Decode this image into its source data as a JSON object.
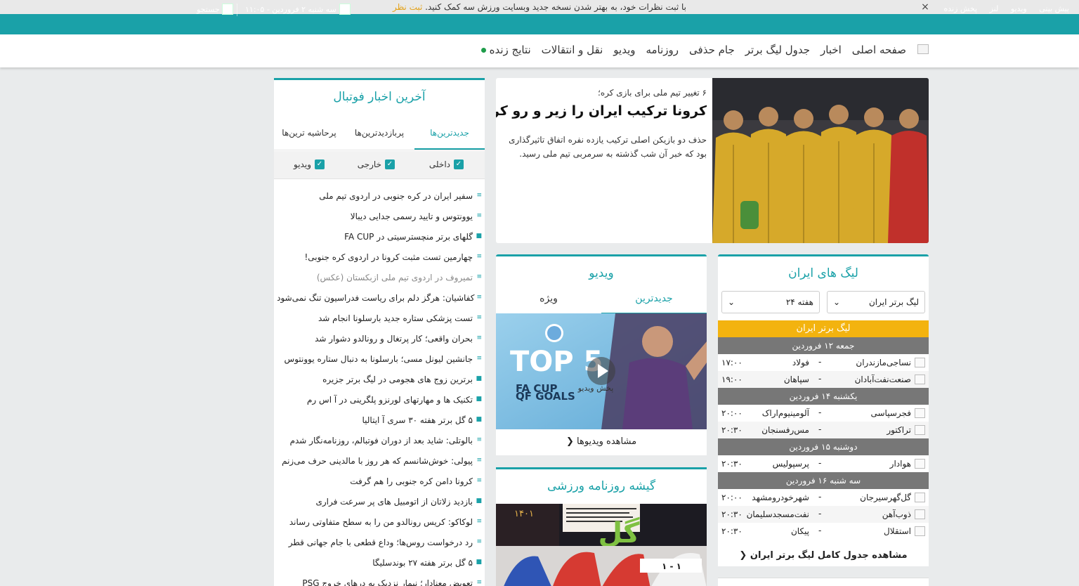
{
  "notice": {
    "text": "با ثبت نظرات خود، به بهتر شدن نسخه جدید وبسایت ورزش سه کمک کنید.",
    "cta": "ثبت نظر",
    "close": "×"
  },
  "topbar": {
    "links": [
      "پیش بینی",
      "ویدیو",
      "لنز",
      "پخش زنده"
    ],
    "date": "سه شنبه ۲ فروردین - ۱۱:۰۵",
    "search": "جستجو"
  },
  "nav": {
    "items": [
      "صفحه اصلی",
      "اخبار",
      "جدول لیگ برتر",
      "جام حذفی",
      "روزنامه",
      "ویدیو",
      "نقل و انتقالات",
      "نتایج زنده"
    ]
  },
  "hero": {
    "subtitle": "۶ تغییر تیم ملی برای بازی کره؛",
    "title": "کرونا ترکیب ایران را زیر و رو کرد!",
    "body": "حذف دو بازیکن اصلی ترکیب یازده نفره اتفاق تاثیرگذاری بود که خبر آن شب گذشته به سرمربی تیم ملی رسید."
  },
  "news": {
    "title": "آخرین اخبار فوتبال",
    "tabs": [
      "جدیدترین‌ها",
      "پربازدیدترین‌ها",
      "پرحاشیه ترین‌ها"
    ],
    "filters": [
      "داخلی",
      "خارجی",
      "ویدیو"
    ],
    "items": [
      {
        "text": "سفیر ایران در کره جنوبی در اردوی تیم ملی",
        "type": "text"
      },
      {
        "text": "یوونتوس و تایید رسمی جدایی دیبالا",
        "type": "text"
      },
      {
        "text": "گلهای برتر منچسترسیتی در FA CUP",
        "type": "video"
      },
      {
        "text": "چهارمین تست مثبت کرونا در اردوی کره جنوبی!",
        "type": "text"
      },
      {
        "text": "تمیروف در اردوی تیم ملی ازبکستان (عکس)",
        "type": "text"
      },
      {
        "text": "کفاشیان: هرگز دلم برای ریاست فدراسیون تنگ نمی‌شود",
        "type": "text"
      },
      {
        "text": "تست پزشکی ستاره جدید بارسلونا انجام شد",
        "type": "text"
      },
      {
        "text": "بحران واقعی؛ کار پرتغال و رونالدو دشوار شد",
        "type": "text"
      },
      {
        "text": "جانشین لیونل مسی؛ بارسلونا به دنبال ستاره یوونتوس",
        "type": "text"
      },
      {
        "text": "برترین زوج های هجومی در لیگ برتر جزیره",
        "type": "video"
      },
      {
        "text": "تکنیک ها و مهارتهای لورنزو پلگرینی در آ اس رم",
        "type": "video"
      },
      {
        "text": "۵ گل برتر هفته ۳۰ سری آ ایتالیا",
        "type": "video"
      },
      {
        "text": "بالوتلی: شاید بعد از دوران فوتبالم، روزنامه‌نگار شدم",
        "type": "text"
      },
      {
        "text": "پیولی: خوش‌شانسم که هر روز با مالدینی حرف می‌زنم",
        "type": "text"
      },
      {
        "text": "کرونا دامن کره جنوبی را هم گرفت",
        "type": "text"
      },
      {
        "text": "بازدید زلاتان از اتومبیل های پر سرعت فراری",
        "type": "video"
      },
      {
        "text": "لوکاکو: کریس رونالدو من را به سطح متفاوتی رساند",
        "type": "text"
      },
      {
        "text": "رد درخواست روس‌ها؛ وداع قطعی با جام جهانی قطر",
        "type": "text"
      },
      {
        "text": "۵ گل برتر هفته ۲۷ بوندسلیگا",
        "type": "video"
      },
      {
        "text": "تعویض معنادار؛ نیمار نزدیک به درهای خروج PSG",
        "type": "text"
      }
    ]
  },
  "video": {
    "title": "ویدیو",
    "tabs": [
      "جدیدترین",
      "ویژه"
    ],
    "thumb": {
      "headline": "TOP 5",
      "line1": "FA CUP",
      "line2": "QF GOALS",
      "play_label": "پخش ویدیو"
    },
    "more": "مشاهده ویدیوها"
  },
  "press": {
    "title": "گیشه روزنامه ورزشی",
    "paper_title": "گل",
    "year": "۱۴۰۱",
    "score": "۱ - ۱"
  },
  "league": {
    "title": "لیگ های ایران",
    "select_league": "لیگ برتر ایران",
    "select_week": "هفته ۲۴",
    "bar": "لیگ برتر ایران",
    "days": [
      {
        "label": "جمعه ۱۲ فروردین",
        "matches": [
          {
            "home": "نساجی‌مازندران",
            "away": "فولاد",
            "time": "۱۷:۰۰"
          },
          {
            "home": "صنعت‌نفت‌آبادان",
            "away": "سپاهان",
            "time": "۱۹:۰۰"
          }
        ]
      },
      {
        "label": "یکشنبه ۱۴ فروردین",
        "matches": [
          {
            "home": "فجرسپاسی",
            "away": "آلومینیوم‌اراک",
            "time": "۲۰:۰۰"
          },
          {
            "home": "تراکتور",
            "away": "مس‌رفسنجان",
            "time": "۲۰:۳۰"
          }
        ]
      },
      {
        "label": "دوشنبه ۱۵ فروردین",
        "matches": [
          {
            "home": "هوادار",
            "away": "پرسپولیس",
            "time": "۲۰:۳۰"
          }
        ]
      },
      {
        "label": "سه شنبه ۱۶ فروردین",
        "matches": [
          {
            "home": "گل‌گهرسیرجان",
            "away": "شهرخودرومشهد",
            "time": "۲۰:۰۰"
          },
          {
            "home": "ذوب‌آهن",
            "away": "نفت‌مسجدسلیمان",
            "time": "۲۰:۳۰"
          },
          {
            "home": "استقلال",
            "away": "پیکان",
            "time": "۲۰:۳۰"
          }
        ]
      }
    ],
    "dash": "-",
    "more": "مشاهده جدول کامل لیگ برتر ایران"
  },
  "colors": {
    "brand": "#1aa1a8",
    "accent": "#f3b30f",
    "day_row": "#777777",
    "live": "#1e9c4a"
  }
}
